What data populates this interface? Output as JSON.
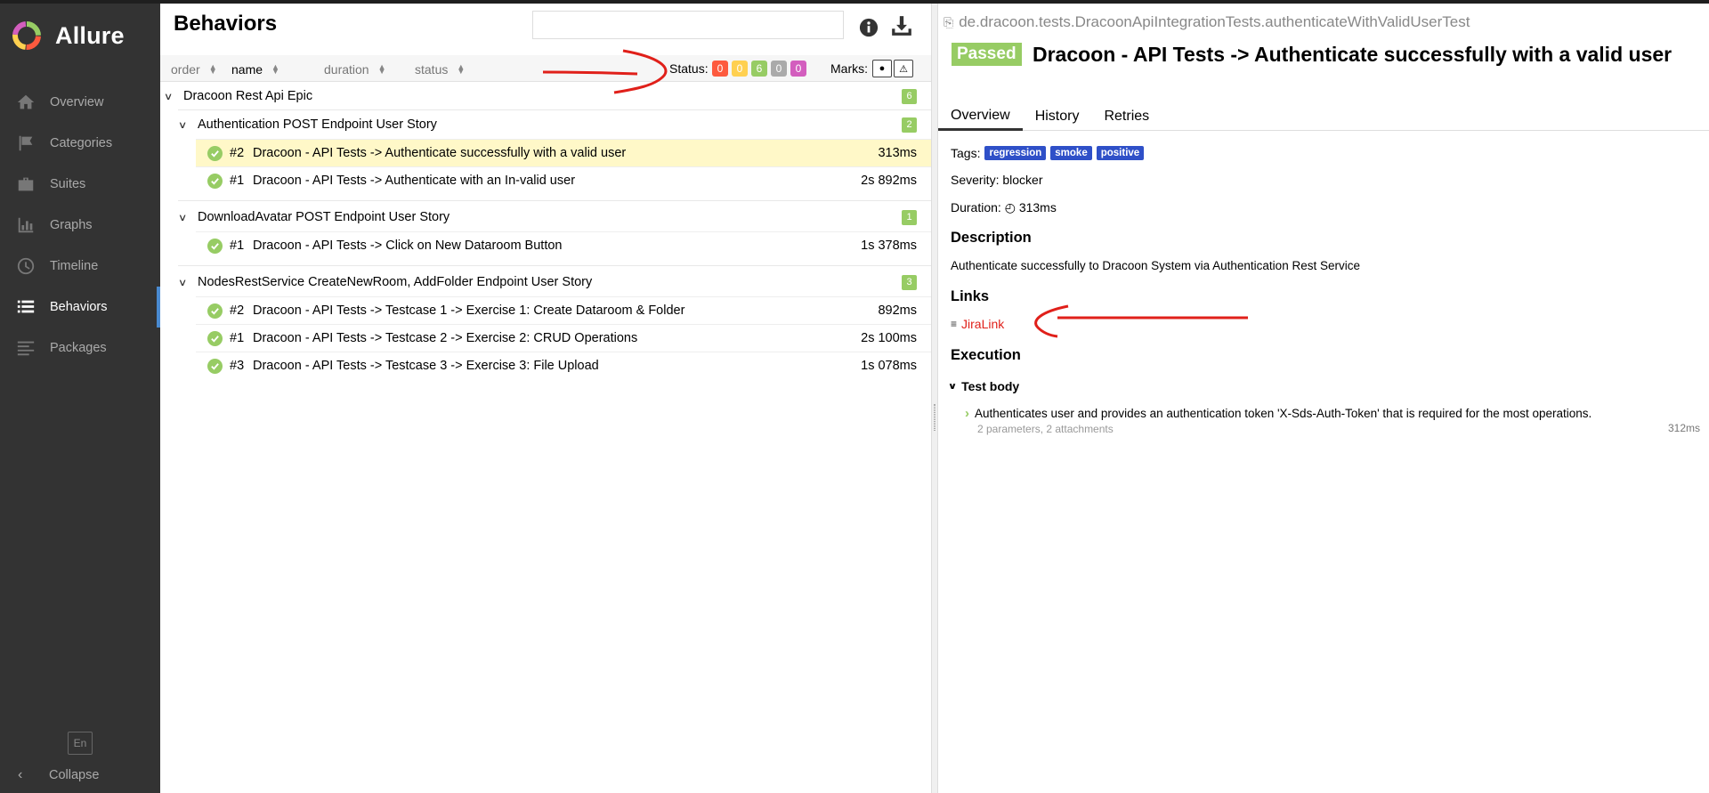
{
  "app": {
    "name": "Allure"
  },
  "sidebar": {
    "items": [
      {
        "label": "Overview",
        "icon": "home-icon",
        "active": false
      },
      {
        "label": "Categories",
        "icon": "flag-icon",
        "active": false
      },
      {
        "label": "Suites",
        "icon": "briefcase-icon",
        "active": false
      },
      {
        "label": "Graphs",
        "icon": "bar-chart-icon",
        "active": false
      },
      {
        "label": "Timeline",
        "icon": "clock-icon",
        "active": false
      },
      {
        "label": "Behaviors",
        "icon": "list-icon",
        "active": true
      },
      {
        "label": "Packages",
        "icon": "align-left-icon",
        "active": false
      }
    ],
    "language": "En",
    "collapse_label": "Collapse"
  },
  "left": {
    "title": "Behaviors",
    "search": {
      "value": "",
      "placeholder": ""
    },
    "sort": [
      "order",
      "name",
      "duration",
      "status"
    ],
    "status_label": "Status:",
    "status_counts": [
      {
        "value": "0",
        "color": "#fd5a3e"
      },
      {
        "value": "0",
        "color": "#ffd050"
      },
      {
        "value": "6",
        "color": "#97cc64"
      },
      {
        "value": "0",
        "color": "#aaaaaa"
      },
      {
        "value": "0",
        "color": "#d35ebe"
      }
    ],
    "marks_label": "Marks:",
    "epic": {
      "name": "Dracoon Rest Api Epic",
      "count": "6"
    },
    "stories": [
      {
        "name": "Authentication POST Endpoint User Story",
        "count": "2",
        "tests": [
          {
            "num": "#2",
            "name": "Dracoon - API Tests -> Authenticate successfully with a valid user",
            "duration": "313ms",
            "selected": true
          },
          {
            "num": "#1",
            "name": "Dracoon - API Tests -> Authenticate with an In-valid user",
            "duration": "2s 892ms",
            "selected": false
          }
        ]
      },
      {
        "name": "DownloadAvatar POST Endpoint User Story",
        "count": "1",
        "tests": [
          {
            "num": "#1",
            "name": "Dracoon - API Tests -> Click on New Dataroom Button",
            "duration": "1s 378ms",
            "selected": false
          }
        ]
      },
      {
        "name": "NodesRestService CreateNewRoom, AddFolder Endpoint User Story",
        "count": "3",
        "tests": [
          {
            "num": "#2",
            "name": "Dracoon - API Tests -> Testcase 1 -> Exercise 1: Create Dataroom & Folder",
            "duration": "892ms",
            "selected": false
          },
          {
            "num": "#1",
            "name": "Dracoon - API Tests -> Testcase 2 -> Exercise 2: CRUD Operations",
            "duration": "2s 100ms",
            "selected": false
          },
          {
            "num": "#3",
            "name": "Dracoon - API Tests -> Testcase 3 -> Exercise 3: File Upload",
            "duration": "1s 078ms",
            "selected": false
          }
        ]
      }
    ]
  },
  "right": {
    "full_name": "de.dracoon.tests.DracoonApiIntegrationTests.authenticateWithValidUserTest",
    "status": "Passed",
    "title": "Dracoon - API Tests -> Authenticate successfully with a valid user",
    "tabs": [
      "Overview",
      "History",
      "Retries"
    ],
    "tags_label": "Tags:",
    "tags": [
      "regression",
      "smoke",
      "positive"
    ],
    "severity": "Severity: blocker",
    "duration_label": "Duration:",
    "duration_value": "313ms",
    "description_heading": "Description",
    "description": "Authenticate successfully to Dracoon System via Authentication Rest Service",
    "links_heading": "Links",
    "link_label": "JiraLink",
    "execution_heading": "Execution",
    "test_body_label": "Test body",
    "step": {
      "text": "Authenticates user and provides an authentication token 'X-Sds-Auth-Token' that is required for the most operations.",
      "meta": "2 parameters, 2 attachments",
      "duration": "312ms"
    }
  },
  "colors": {
    "annotation": "#e0201a",
    "passed": "#97cc64",
    "tag": "#2f50c8",
    "sidebar": "#333333"
  }
}
